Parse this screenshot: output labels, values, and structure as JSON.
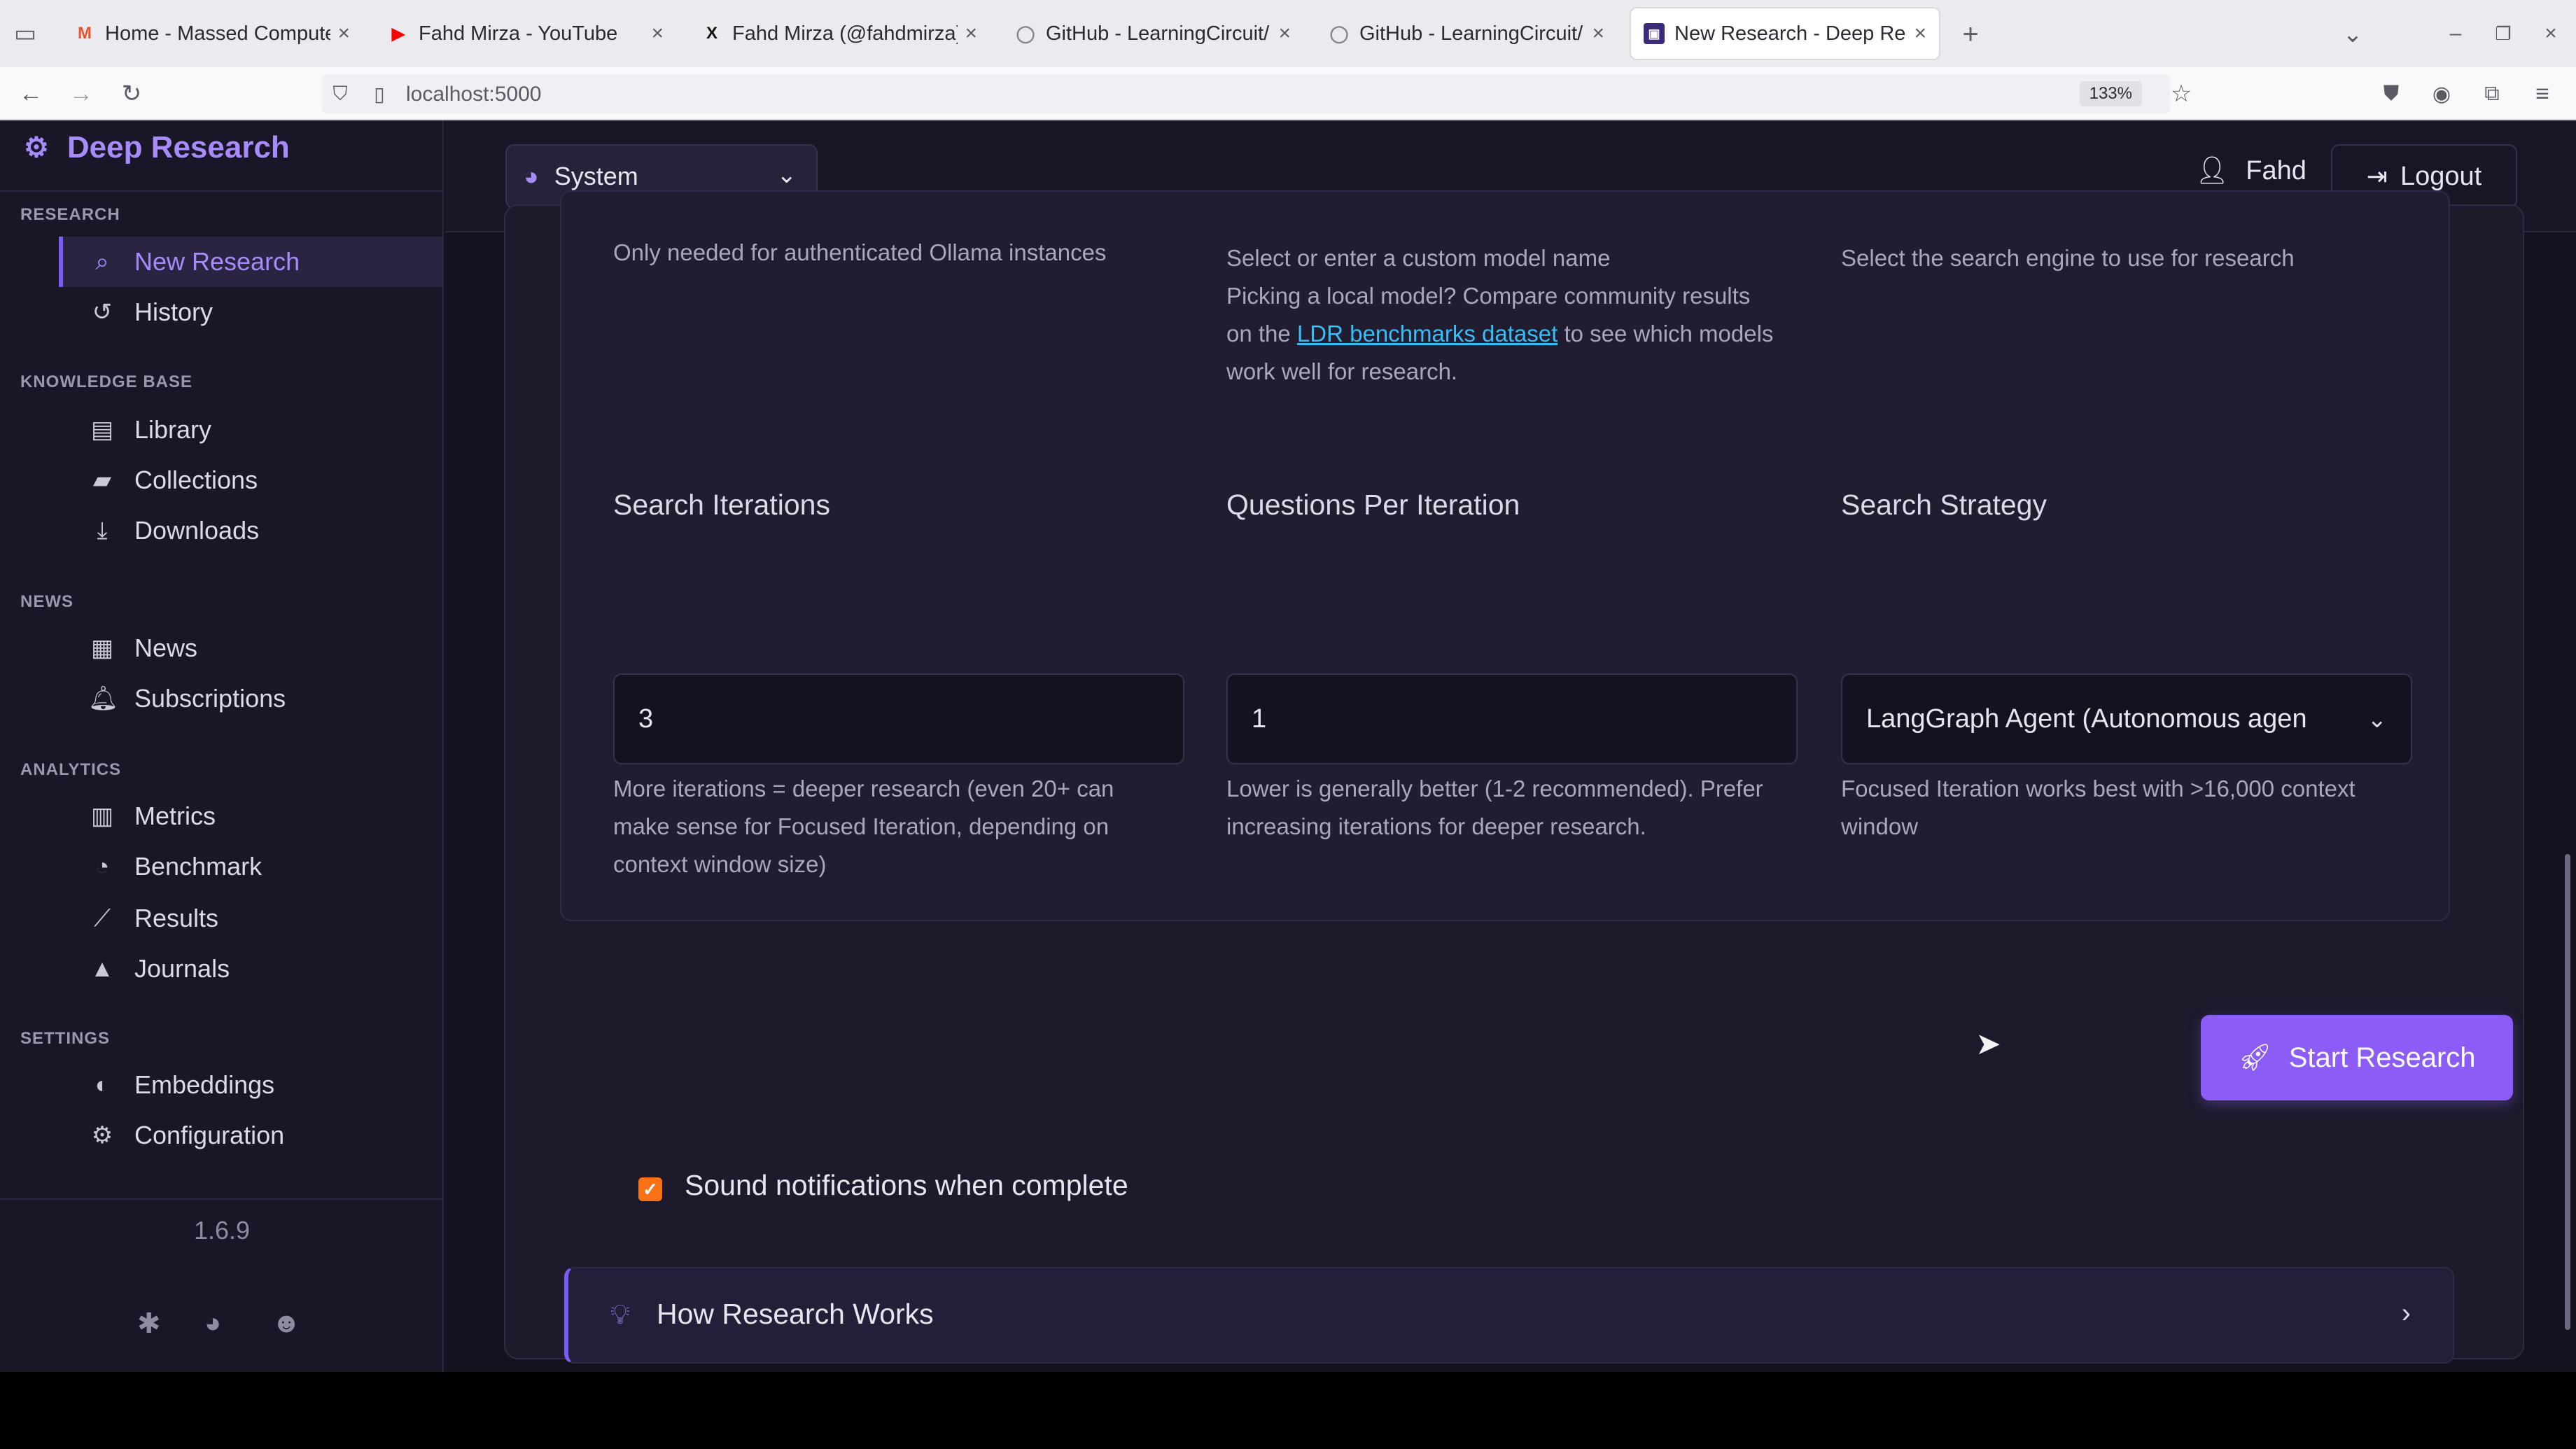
{
  "browser": {
    "tabs": [
      {
        "title": "Home - Massed Compute",
        "favicon": "massed-compute-icon"
      },
      {
        "title": "Fahd Mirza - YouTube",
        "favicon": "youtube-icon"
      },
      {
        "title": "Fahd Mirza (@fahdmirza)",
        "favicon": "x-icon"
      },
      {
        "title": "GitHub - LearningCircuit/",
        "favicon": "github-icon"
      },
      {
        "title": "GitHub - LearningCircuit/",
        "favicon": "github-icon"
      },
      {
        "title": "New Research - Deep Re",
        "favicon": "deep-research-icon"
      }
    ],
    "url": "localhost:5000",
    "zoom": "133%"
  },
  "sidebar": {
    "brand": "Deep Research",
    "sections": {
      "research": "RESEARCH",
      "knowledge": "KNOWLEDGE BASE",
      "news": "NEWS",
      "analytics": "ANALYTICS",
      "settings": "SETTINGS"
    },
    "items": {
      "new_research": "New Research",
      "history": "History",
      "library": "Library",
      "collections": "Collections",
      "downloads": "Downloads",
      "news": "News",
      "subscriptions": "Subscriptions",
      "metrics": "Metrics",
      "benchmark": "Benchmark",
      "results": "Results",
      "journals": "Journals",
      "embeddings": "Embeddings",
      "configuration": "Configuration"
    },
    "version": "1.6.9"
  },
  "topbar": {
    "theme": "System",
    "user": "Fahd",
    "logout": "Logout"
  },
  "form": {
    "ollama_help": "Only needed for authenticated Ollama instances",
    "model_help": "Select or enter a custom model name",
    "model_tip_1": "Picking a local model? Compare community results",
    "model_tip_2_pre": "on the",
    "model_tip_link": "LDR benchmarks dataset",
    "model_tip_2_post": "to see which models",
    "model_tip_3": "work well for research.",
    "engine_help": "Select the search engine to use for research",
    "iterations": {
      "label": "Search Iterations",
      "value": "3",
      "help_1": "More iterations = deeper research (even 20+ can",
      "help_2": "make sense for Focused Iteration, depending on",
      "help_3": "context window size)"
    },
    "questions": {
      "label": "Questions Per Iteration",
      "value": "1",
      "help_1": "Lower is generally better (1-2 recommended). Prefer",
      "help_2": "increasing iterations for deeper research."
    },
    "strategy": {
      "label": "Search Strategy",
      "value": "LangGraph Agent (Autonomous agen",
      "help_1": "Focused Iteration works best with >16,000 context",
      "help_2": "window"
    },
    "start_button": "Start Research",
    "sound_label": "Sound notifications when complete",
    "sound_checked": true,
    "how_title": "How Research Works"
  },
  "colors": {
    "accent": "#8b5cf6",
    "checkbox": "#f97316",
    "link": "#38bdf8"
  }
}
